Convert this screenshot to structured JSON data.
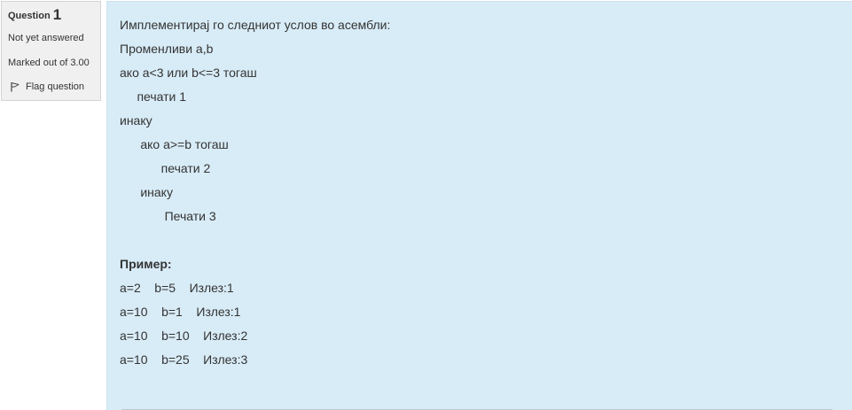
{
  "info": {
    "question_label": "Question",
    "question_number": "1",
    "state": "Not yet answered",
    "grade": "Marked out of 3.00",
    "flag_label": "Flag question",
    "flag_icon": "flag-icon"
  },
  "question": {
    "lines": [
      "Имплементирај го следниот услов во асембли:",
      "Променливи a,b",
      "ако a<3 или b<=3 тогаш",
      "     печати 1",
      "инаку",
      "      ако a>=b тогаш",
      "            печати 2",
      "      инаку",
      "             Печати 3",
      "",
      "Пример:",
      "a=2    b=5    Излез:1",
      "a=10    b=1    Излез:1",
      "a=10    b=10    Излез:2",
      "a=10    b=25    Излез:3"
    ]
  },
  "colors": {
    "content_bg": "#d8ecf7",
    "info_bg": "#f0f0f0",
    "text": "#333333"
  }
}
